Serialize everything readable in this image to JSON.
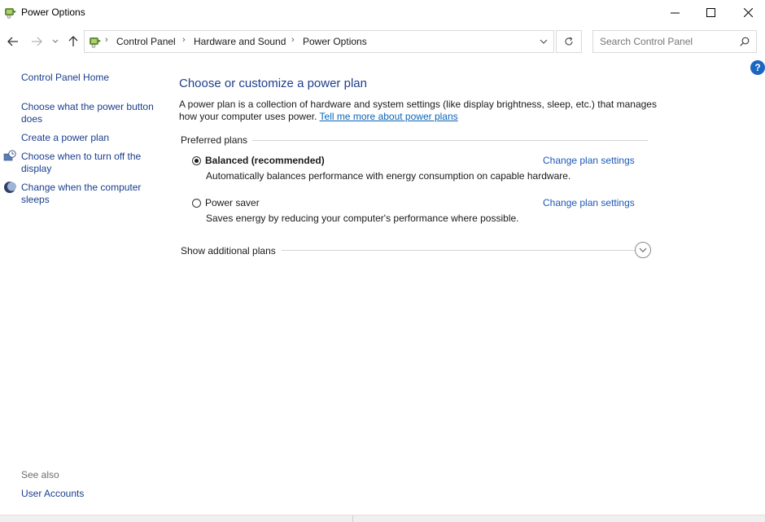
{
  "window": {
    "title": "Power Options",
    "controls": {
      "minimize": "minimize-icon",
      "maximize": "maximize-icon",
      "close": "close-icon"
    }
  },
  "nav": {
    "back": "back-arrow-icon",
    "forward": "forward-arrow-icon",
    "recent": "chevron-down-icon",
    "up": "up-arrow-icon"
  },
  "breadcrumb": {
    "items": [
      "Control Panel",
      "Hardware and Sound",
      "Power Options"
    ]
  },
  "search": {
    "placeholder": "Search Control Panel"
  },
  "help": {
    "label": "?"
  },
  "sidebar": {
    "home": "Control Panel Home",
    "links": [
      {
        "label": "Choose what the power button does"
      },
      {
        "label": "Create a power plan"
      },
      {
        "label": "Choose when to turn off the display",
        "icon": "display-clock-icon"
      },
      {
        "label": "Change when the computer sleeps",
        "icon": "moon-icon"
      }
    ],
    "see_also": "See also",
    "see_also_links": [
      "User Accounts"
    ]
  },
  "main": {
    "title": "Choose or customize a power plan",
    "description": "A power plan is a collection of hardware and system settings (like display brightness, sleep, etc.) that manages how your computer uses power.",
    "learn_more": "Tell me more about power plans",
    "section": "Preferred plans",
    "plans": [
      {
        "name": "Balanced (recommended)",
        "selected": true,
        "description": "Automatically balances performance with energy consumption on capable hardware.",
        "action": "Change plan settings"
      },
      {
        "name": "Power saver",
        "selected": false,
        "description": "Saves energy by reducing your computer's performance where possible.",
        "action": "Change plan settings"
      }
    ],
    "show_more": "Show additional plans"
  },
  "colors": {
    "link": "#1b3e8e",
    "title": "#1e3e8c",
    "help": "#1c66c3"
  }
}
